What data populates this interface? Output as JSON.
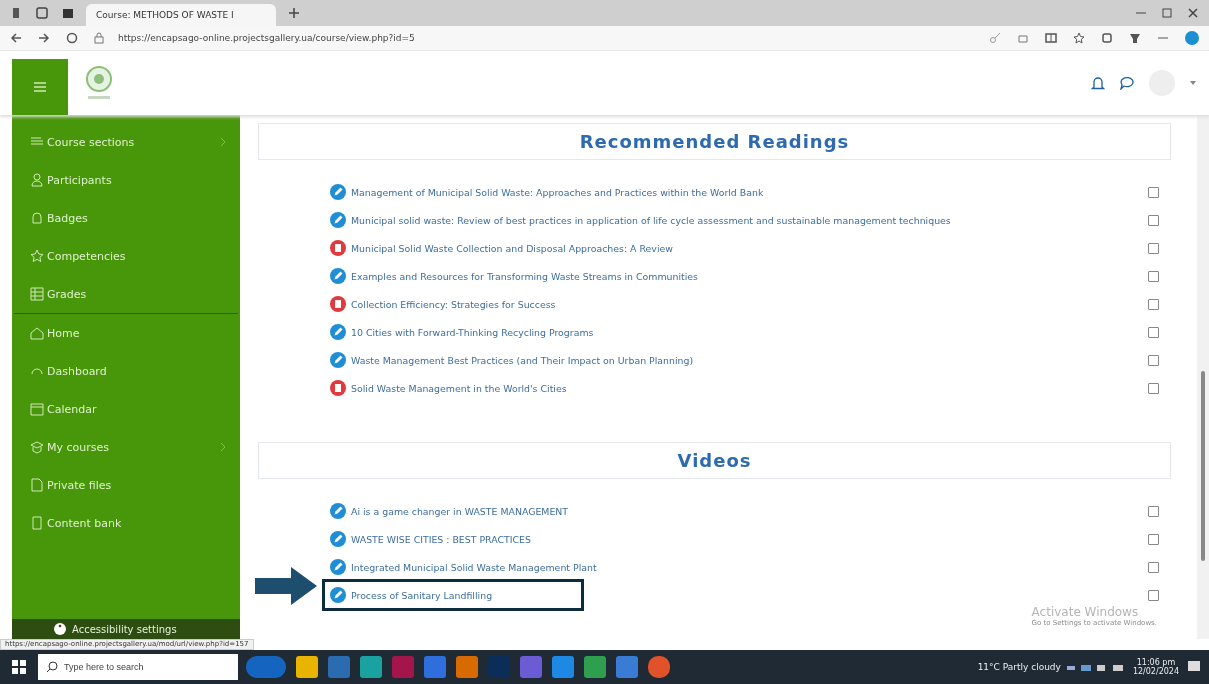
{
  "browser": {
    "tab_title": "Course: METHODS OF WASTE I",
    "url": "https://encapsago-online.projectsgallery.ua/course/view.php?id=5"
  },
  "sidebar": {
    "course_items": [
      {
        "label": "Course sections",
        "kind": "sections",
        "submenu": true
      },
      {
        "label": "Participants",
        "kind": "people",
        "submenu": false
      },
      {
        "label": "Badges",
        "kind": "badge",
        "submenu": false
      },
      {
        "label": "Competencies",
        "kind": "star",
        "submenu": false
      },
      {
        "label": "Grades",
        "kind": "grid",
        "submenu": false
      }
    ],
    "site_items": [
      {
        "label": "Home",
        "kind": "home",
        "submenu": false
      },
      {
        "label": "Dashboard",
        "kind": "gauge",
        "submenu": false
      },
      {
        "label": "Calendar",
        "kind": "calendar",
        "submenu": false
      },
      {
        "label": "My courses",
        "kind": "cap",
        "submenu": true
      },
      {
        "label": "Private files",
        "kind": "file",
        "submenu": false
      },
      {
        "label": "Content bank",
        "kind": "bank",
        "submenu": false
      }
    ],
    "footer": "Accessibility settings"
  },
  "sections": [
    {
      "title": "Recommended Readings",
      "items": [
        {
          "label": "Management of Municipal Solid Waste: Approaches and Practices within the World Bank",
          "kind": "link",
          "checked": false
        },
        {
          "label": "Municipal solid waste: Review of best practices in application of life cycle assessment and sustainable management techniques",
          "kind": "link",
          "checked": false
        },
        {
          "label": "Municipal Solid Waste Collection and Disposal Approaches: A Review",
          "kind": "pdf",
          "checked": false
        },
        {
          "label": "Examples and Resources for Transforming Waste Streams in Communities",
          "kind": "link",
          "checked": false
        },
        {
          "label": "Collection Efficiency: Strategies for Success",
          "kind": "pdf",
          "checked": false
        },
        {
          "label": "10 Cities with Forward-Thinking Recycling Programs",
          "kind": "link",
          "checked": false
        },
        {
          "label": "Waste Management Best Practices (and Their Impact on Urban Planning)",
          "kind": "link",
          "checked": false
        },
        {
          "label": "Solid Waste Management in the World's Cities",
          "kind": "pdf",
          "checked": false
        }
      ]
    },
    {
      "title": "Videos",
      "items": [
        {
          "label": "Ai is a game changer in WASTE MANAGEMENT",
          "kind": "link",
          "checked": false
        },
        {
          "label": "WASTE WISE CITIES : BEST PRACTICES",
          "kind": "link",
          "checked": false
        },
        {
          "label": "Integrated Municipal Solid Waste Management Plant",
          "kind": "link",
          "checked": false
        },
        {
          "label": "Process of Sanitary Landfilling",
          "kind": "link",
          "checked": false
        }
      ]
    }
  ],
  "activation": {
    "title": "Activate Windows",
    "text": "Go to Settings to activate Windows."
  },
  "status_url": "https://encapsago-online.projectsgallery.ua/mod/url/view.php?id=157",
  "taskbar": {
    "search_placeholder": "Type here to search",
    "weather": "11°C Partly cloudy",
    "time": "11:06 pm",
    "date": "12/02/2024"
  }
}
